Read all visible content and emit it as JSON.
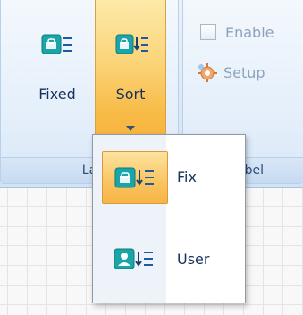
{
  "ribbon": {
    "buttons": {
      "fixed_label": "Fixed",
      "sort_label": "Sort"
    },
    "options": {
      "enable_label": "Enable",
      "setup_label": "Setup"
    },
    "groups": {
      "first_label": "La",
      "second_label": "bel"
    }
  },
  "dropdown": {
    "items": [
      {
        "label": "Fix",
        "icon": "fix-sort-icon",
        "selected": true
      },
      {
        "label": "User",
        "icon": "user-sort-icon",
        "selected": false
      }
    ]
  },
  "colors": {
    "accent_orange": "#f8bb47",
    "ribbon_blue": "#dbe8f6",
    "text_blue": "#15325e",
    "icon_teal": "#1aa5a8"
  }
}
